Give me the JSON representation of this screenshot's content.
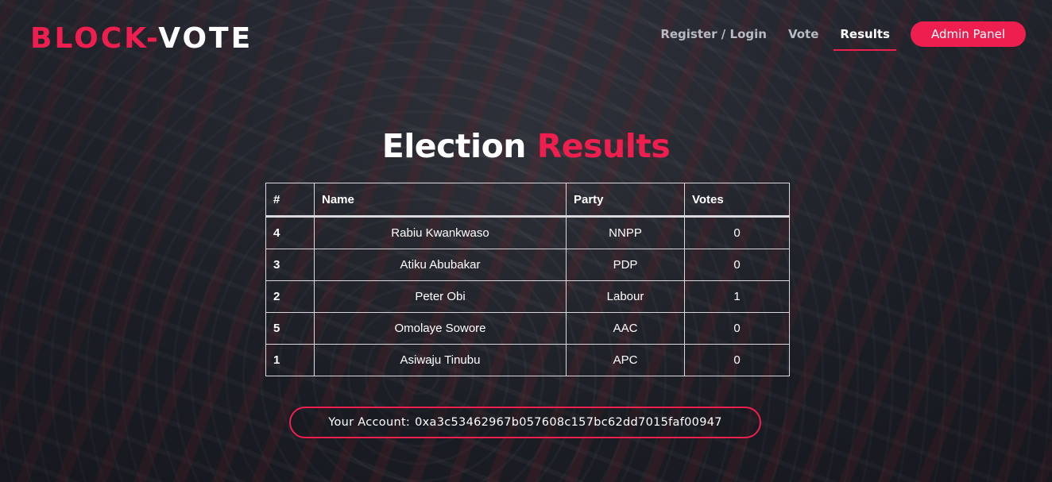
{
  "brand": {
    "part1": "BLOCK-",
    "part2": "VOTE"
  },
  "nav": {
    "items": [
      {
        "label": "Register / Login"
      },
      {
        "label": "Vote"
      },
      {
        "label": "Results"
      }
    ],
    "active": "Results",
    "admin_label": "Admin Panel"
  },
  "page": {
    "title_main": "Election",
    "title_accent": "Results"
  },
  "table": {
    "headers": [
      "#",
      "Name",
      "Party",
      "Votes"
    ],
    "rows": [
      {
        "id": "4",
        "name": "Rabiu Kwankwaso",
        "party": "NNPP",
        "votes": "0"
      },
      {
        "id": "3",
        "name": "Atiku Abubakar",
        "party": "PDP",
        "votes": "0"
      },
      {
        "id": "2",
        "name": "Peter Obi",
        "party": "Labour",
        "votes": "1"
      },
      {
        "id": "5",
        "name": "Omolaye Sowore",
        "party": "AAC",
        "votes": "0"
      },
      {
        "id": "1",
        "name": "Asiwaju Tinubu",
        "party": "APC",
        "votes": "0"
      }
    ]
  },
  "account": {
    "label": "Your Account:",
    "address": "0xa3c53462967b057608c157bc62dd7015faf00947"
  },
  "colors": {
    "accent": "#ee1f4f",
    "text": "#ffffff",
    "nav_inactive": "#b9bbc3"
  }
}
